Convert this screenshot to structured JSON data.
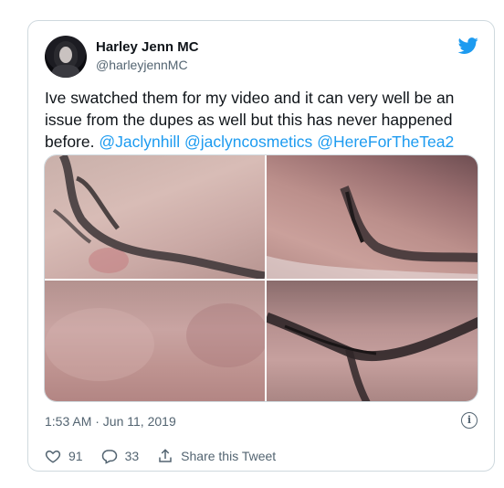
{
  "tweet": {
    "author_name": "Harley Jenn MC",
    "author_handle": "@harleyjennMC",
    "text_plain": "Ive swatched them for my video and it can very well be an issue from the dupes as well but this has never happened before. ",
    "mentions": [
      "@Jaclynhill",
      "@jaclyncosmetics",
      "@HereForTheTea2"
    ],
    "timestamp": "1:53 AM · Jun 11, 2019",
    "likes": "91",
    "replies": "33",
    "share_label": "Share this Tweet"
  },
  "images": [
    {
      "alt": "tattoo-swatch-photo-1"
    },
    {
      "alt": "tattoo-swatch-photo-2"
    },
    {
      "alt": "skin-swatch-photo-3"
    },
    {
      "alt": "tattoo-swatch-photo-4"
    }
  ],
  "colors": {
    "accent": "#1d9bf0",
    "text": "#0f1419",
    "secondary": "#536471",
    "border": "#cfd9de"
  },
  "icons": [
    "twitter-bird-icon",
    "info-icon",
    "heart-icon",
    "reply-icon",
    "share-icon"
  ]
}
